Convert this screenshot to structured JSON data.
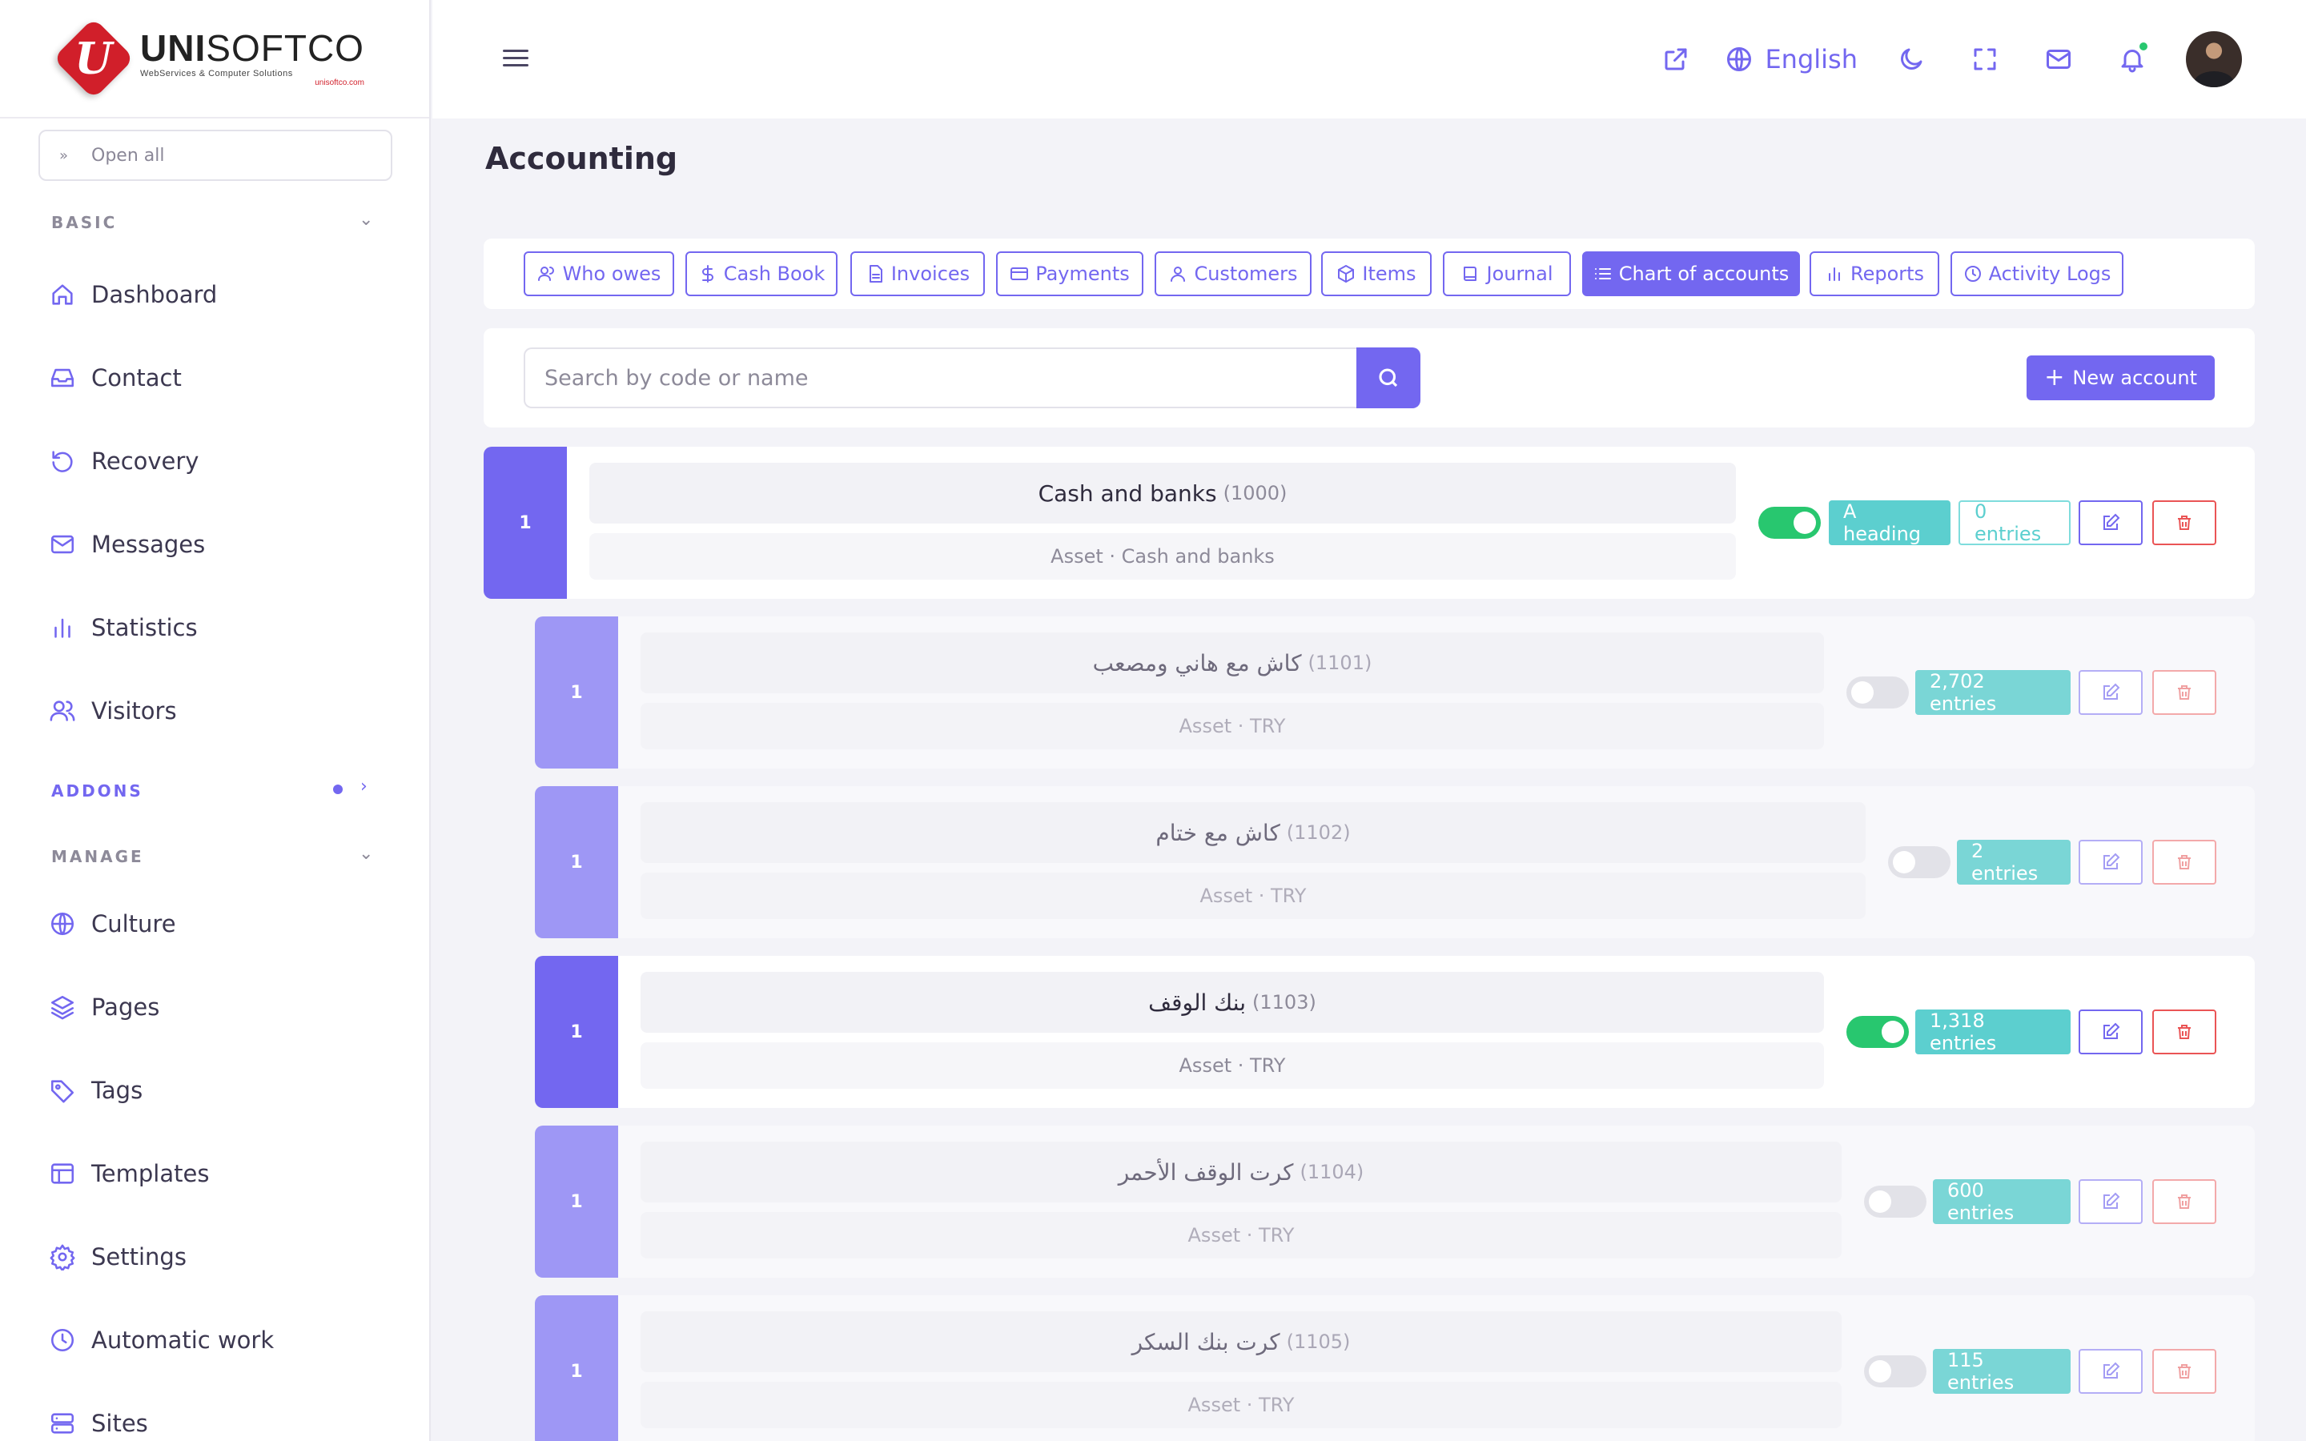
{
  "brand": {
    "logo_letter": "U",
    "name_bold": "UNI",
    "name_light": "SOFTCO",
    "tagline": "WebServices & Computer Solutions",
    "url": "unisoftco.com"
  },
  "sidebar": {
    "open_all": "Open all",
    "sections": {
      "basic": "BASIC",
      "addons": "ADDONS",
      "manage": "MANAGE"
    },
    "basic_items": [
      {
        "label": "Dashboard",
        "icon": "home-icon"
      },
      {
        "label": "Contact",
        "icon": "inbox-icon"
      },
      {
        "label": "Recovery",
        "icon": "restore-icon"
      },
      {
        "label": "Messages",
        "icon": "mail-icon"
      },
      {
        "label": "Statistics",
        "icon": "chart-icon"
      },
      {
        "label": "Visitors",
        "icon": "users-icon"
      }
    ],
    "manage_items": [
      {
        "label": "Culture",
        "icon": "globe-icon"
      },
      {
        "label": "Pages",
        "icon": "layers-icon"
      },
      {
        "label": "Tags",
        "icon": "tag-icon"
      },
      {
        "label": "Templates",
        "icon": "layout-icon"
      },
      {
        "label": "Settings",
        "icon": "gear-icon"
      },
      {
        "label": "Automatic work",
        "icon": "clock-icon"
      },
      {
        "label": "Sites",
        "icon": "server-icon"
      }
    ]
  },
  "header": {
    "language": "English"
  },
  "page": {
    "title": "Accounting"
  },
  "tabs": [
    {
      "label": "Who owes",
      "icon": "users-icon"
    },
    {
      "label": "Cash Book",
      "icon": "dollar-icon"
    },
    {
      "label": "Invoices",
      "icon": "file-icon"
    },
    {
      "label": "Payments",
      "icon": "credit-card-icon"
    },
    {
      "label": "Customers",
      "icon": "user-icon"
    },
    {
      "label": "Items",
      "icon": "box-icon"
    },
    {
      "label": "Journal",
      "icon": "book-icon"
    },
    {
      "label": "Chart of accounts",
      "icon": "list-icon",
      "active": true
    },
    {
      "label": "Reports",
      "icon": "chart-icon"
    },
    {
      "label": "Activity Logs",
      "icon": "clock-icon"
    }
  ],
  "search": {
    "placeholder": "Search by code or name",
    "new_account": "New account"
  },
  "accounts": [
    {
      "level": "1",
      "name": "Cash and banks",
      "code": "(1000)",
      "meta": "Asset · Cash and banks",
      "enabled": true,
      "badge": "A heading",
      "entries": "0 entries"
    },
    {
      "level": "1",
      "name": "كاش مع هاني ومصعب",
      "code": "(1101)",
      "meta": "Asset · TRY",
      "enabled": false,
      "entries": "2,702 entries"
    },
    {
      "level": "1",
      "name": "كاش مع ختام",
      "code": "(1102)",
      "meta": "Asset · TRY",
      "enabled": false,
      "entries": "2 entries"
    },
    {
      "level": "1",
      "name": "بنك الوقف",
      "code": "(1103)",
      "meta": "Asset · TRY",
      "enabled": true,
      "entries": "1,318 entries"
    },
    {
      "level": "1",
      "name": "كرت الوقف الأحمر",
      "code": "(1104)",
      "meta": "Asset · TRY",
      "enabled": false,
      "entries": "600 entries"
    },
    {
      "level": "1",
      "name": "كرت بنك السكر",
      "code": "(1105)",
      "meta": "Asset · TRY",
      "enabled": false,
      "entries": "115 entries"
    }
  ],
  "colors": {
    "primary": "#7367f0",
    "success": "#28c76f",
    "info": "#5ccfcf",
    "danger": "#ea5455"
  }
}
